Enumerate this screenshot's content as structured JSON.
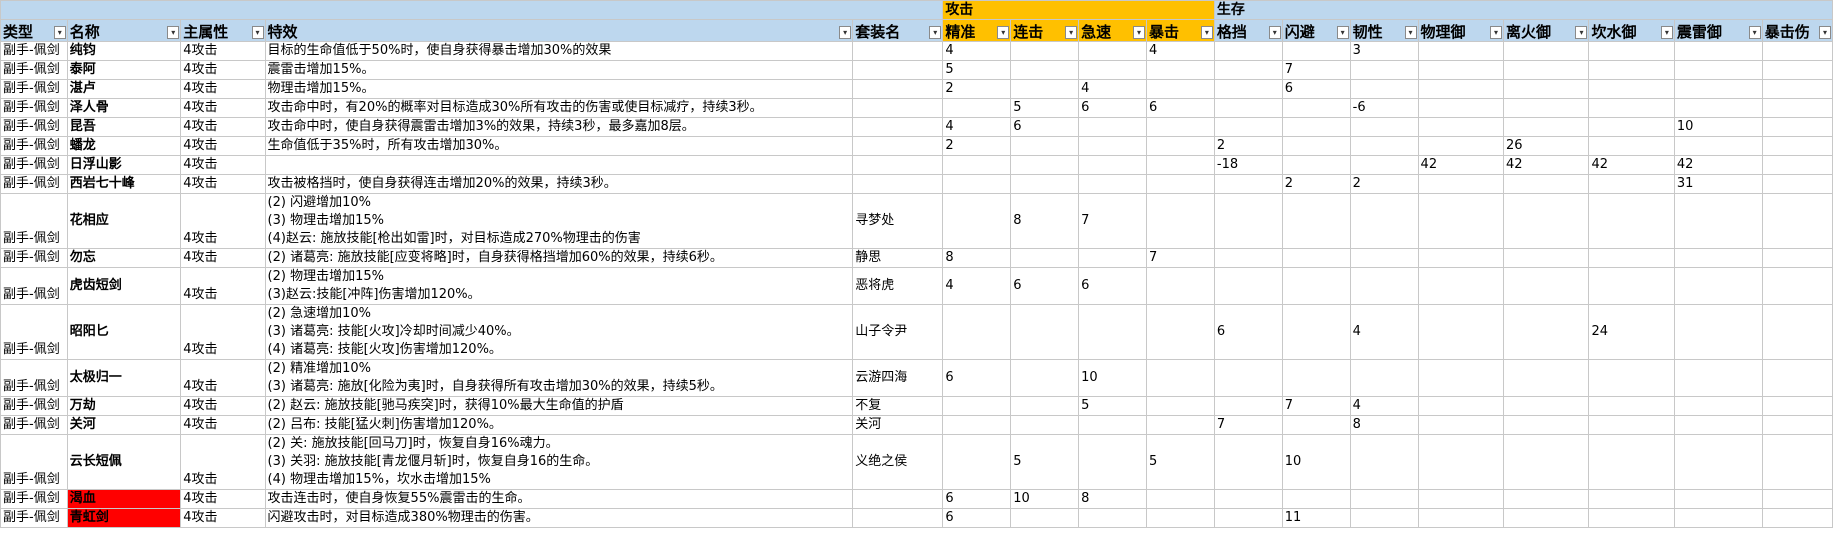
{
  "colors": {
    "header_blue": "#bdd7ee",
    "header_orange": "#ffc000",
    "highlight_red": "#ff0000"
  },
  "groups": {
    "attack": "攻击",
    "survival": "生存"
  },
  "headers": [
    "类型",
    "名称",
    "主属性",
    "特效",
    "套装名",
    "精准",
    "连击",
    "急速",
    "暴击",
    "格挡",
    "闪避",
    "韧性",
    "物理御",
    "离火御",
    "坎水御",
    "震雷御",
    "暴击伤"
  ],
  "rows": [
    {
      "type": "副手-佩剑",
      "name": "纯钧",
      "main": "4攻击",
      "effects": [
        "目标的生命值低于50%时，使自身获得暴击增加30%的效果"
      ],
      "set": "",
      "vals": [
        "4",
        "",
        "",
        "4",
        "",
        "",
        "3",
        "",
        "",
        "",
        "",
        ""
      ]
    },
    {
      "type": "副手-佩剑",
      "name": "泰阿",
      "main": "4攻击",
      "effects": [
        "震雷击增加15%。"
      ],
      "set": "",
      "vals": [
        "5",
        "",
        "",
        "",
        "",
        "7",
        "",
        "",
        "",
        "",
        "",
        ""
      ]
    },
    {
      "type": "副手-佩剑",
      "name": "湛卢",
      "main": "4攻击",
      "effects": [
        "物理击增加15%。"
      ],
      "set": "",
      "vals": [
        "2",
        "",
        "4",
        "",
        "",
        "6",
        "",
        "",
        "",
        "",
        "",
        ""
      ]
    },
    {
      "type": "副手-佩剑",
      "name": "泽人骨",
      "main": "4攻击",
      "effects": [
        "攻击命中时，有20%的概率对目标造成30%所有攻击的伤害或使目标减疗，持续3秒。"
      ],
      "set": "",
      "vals": [
        "",
        "5",
        "6",
        "6",
        "",
        "",
        "-6",
        "",
        "",
        "",
        "",
        ""
      ]
    },
    {
      "type": "副手-佩剑",
      "name": "昆吾",
      "main": "4攻击",
      "effects": [
        "攻击命中时，使自身获得震雷击增加3%的效果，持续3秒，最多嘉加8层。"
      ],
      "set": "",
      "vals": [
        "4",
        "6",
        "",
        "",
        "",
        "",
        "",
        "",
        "",
        "",
        "10",
        ""
      ]
    },
    {
      "type": "副手-佩剑",
      "name": "蟠龙",
      "main": "4攻击",
      "effects": [
        "生命值低于35%时，所有攻击增加30%。"
      ],
      "set": "",
      "vals": [
        "2",
        "",
        "",
        "",
        "2",
        "",
        "",
        "",
        "26",
        "",
        "",
        ""
      ]
    },
    {
      "type": "副手-佩剑",
      "name": "日浮山影",
      "main": "4攻击",
      "effects": [
        ""
      ],
      "set": "",
      "vals": [
        "",
        "",
        "",
        "",
        "-18",
        "",
        "",
        "42",
        "42",
        "42",
        "42",
        ""
      ]
    },
    {
      "type": "副手-佩剑",
      "name": "西岩七十峰",
      "main": "4攻击",
      "effects": [
        "攻击被格挡时，使自身获得连击增加20%的效果，持续3秒。"
      ],
      "set": "",
      "vals": [
        "",
        "",
        "",
        "",
        "",
        "2",
        "2",
        "",
        "",
        "",
        "31",
        ""
      ]
    },
    {
      "type": "副手-佩剑",
      "name": "花相应",
      "main": "4攻击",
      "effects": [
        "(2) 闪避增加10%",
        "(3) 物理击增加15%",
        "(4)赵云: 施放技能[枪出如雷]时，对目标造成270%物理击的伤害"
      ],
      "set": "寻梦处",
      "vals": [
        "",
        "8",
        "7",
        "",
        "",
        "",
        "",
        "",
        "",
        "",
        "",
        ""
      ]
    },
    {
      "type": "副手-佩剑",
      "name": "勿忘",
      "main": "4攻击",
      "effects": [
        "(2) 诸葛亮: 施放技能[应变将略]时，自身获得格挡增加60%的效果，持续6秒。"
      ],
      "set": "静思",
      "vals": [
        "8",
        "",
        "",
        "7",
        "",
        "",
        "",
        "",
        "",
        "",
        "",
        ""
      ]
    },
    {
      "type": "副手-佩剑",
      "name": "虎齿短剑",
      "main": "4攻击",
      "effects": [
        "(2) 物理击增加15%",
        "(3)赵云:技能[冲阵]伤害增加120%。"
      ],
      "set": "恶将虎",
      "vals": [
        "4",
        "6",
        "6",
        "",
        "",
        "",
        "",
        "",
        "",
        "",
        "",
        ""
      ]
    },
    {
      "type": "副手-佩剑",
      "name": "昭阳匕",
      "main": "4攻击",
      "effects": [
        "(2) 急速增加10%",
        "(3) 诸葛亮: 技能[火攻]冷却时间减少40%。",
        "(4) 诸葛亮: 技能[火攻]伤害增加120%。"
      ],
      "set": "山子令尹",
      "vals": [
        "",
        "",
        "",
        "",
        "6",
        "",
        "4",
        "",
        "",
        "24",
        "",
        ""
      ]
    },
    {
      "type": "副手-佩剑",
      "name": "太极归一",
      "main": "4攻击",
      "effects": [
        "(2) 精准增加10%",
        "(3) 诸葛亮: 施放[化险为夷]时，自身获得所有攻击增加30%的效果，持续5秒。"
      ],
      "set": "云游四海",
      "vals": [
        "6",
        "",
        "10",
        "",
        "",
        "",
        "",
        "",
        "",
        "",
        "",
        ""
      ]
    },
    {
      "type": "副手-佩剑",
      "name": "万劫",
      "main": "4攻击",
      "effects": [
        "(2) 赵云: 施放技能[驰马疾突]时，获得10%最大生命值的护盾"
      ],
      "set": "不复",
      "vals": [
        "",
        "",
        "5",
        "",
        "",
        "7",
        "4",
        "",
        "",
        "",
        "",
        ""
      ]
    },
    {
      "type": "副手-佩剑",
      "name": "关河",
      "main": "4攻击",
      "effects": [
        "(2) 吕布: 技能[猛火刺]伤害增加120%。"
      ],
      "set": "关河",
      "vals": [
        "",
        "",
        "",
        "",
        "7",
        "",
        "8",
        "",
        "",
        "",
        "",
        ""
      ]
    },
    {
      "type": "副手-佩剑",
      "name": "云长短佩",
      "main": "4攻击",
      "effects": [
        "(2) 关: 施放技能[回马刀]时，恢复自身16%魂力。",
        "(3) 关羽: 施放技能[青龙偃月斩]时，恢复自身16的生命。",
        "(4) 物理击增加15%，坎水击增加15%"
      ],
      "set": "义绝之侯",
      "vals": [
        "",
        "5",
        "",
        "5",
        "",
        "10",
        "",
        "",
        "",
        "",
        "",
        ""
      ]
    },
    {
      "type": "副手-佩剑",
      "name": "渴血",
      "main": "4攻击",
      "effects": [
        "攻击连击时，使自身恢复55%震雷击的生命。"
      ],
      "set": "",
      "vals": [
        "6",
        "10",
        "8",
        "",
        "",
        "",
        "",
        "",
        "",
        "",
        "",
        ""
      ],
      "highlight": true
    },
    {
      "type": "副手-佩剑",
      "name": "青虹剑",
      "main": "4攻击",
      "effects": [
        "闪避攻击时，对目标造成380%物理击的伤害。"
      ],
      "set": "",
      "vals": [
        "6",
        "",
        "",
        "",
        "",
        "11",
        "",
        "",
        "",
        "",
        "",
        ""
      ],
      "highlight": true
    }
  ]
}
